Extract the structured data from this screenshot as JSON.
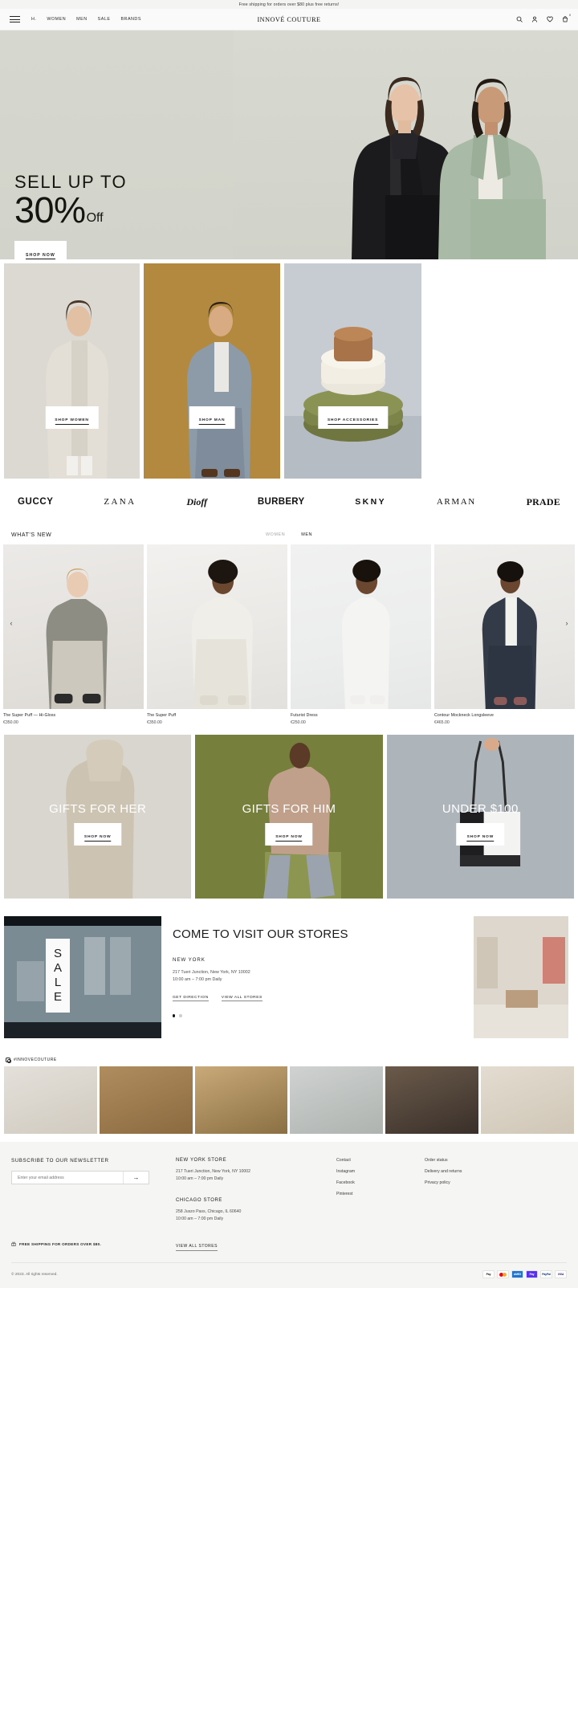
{
  "announcement": "Free shipping for orders over $80 plus free returns!",
  "header": {
    "brand": "INNOVÉ COUTURE",
    "menu_icon": "hamburger-icon",
    "nav": [
      {
        "label": "H."
      },
      {
        "label": "WOMEN"
      },
      {
        "label": "MEN"
      },
      {
        "label": "SALE"
      },
      {
        "label": "BRANDS"
      }
    ],
    "icons": {
      "search": "search-icon",
      "account": "user-icon",
      "wishlist": "heart-icon",
      "cart": "bag-icon",
      "cart_count": "0"
    }
  },
  "hero": {
    "line1": "SELL UP TO",
    "percent": "30%",
    "off": "Off",
    "cta": "SHOP NOW"
  },
  "categories": [
    {
      "cta": "SHOP WOMEN"
    },
    {
      "cta": "SHOP MAN"
    },
    {
      "cta": "SHOP ACCESSORIES"
    }
  ],
  "brands": [
    "GUCCY",
    "ZANA",
    "Dioff",
    "BURBERY",
    "SKNY",
    "ARMAN",
    "PRADE"
  ],
  "whats_new": {
    "title": "WHAT'S NEW",
    "tabs": [
      {
        "label": "WOMEN",
        "active": false
      },
      {
        "label": "MEN",
        "active": true
      }
    ],
    "prev_icon": "chevron-left-icon",
    "next_icon": "chevron-right-icon",
    "products": [
      {
        "name": "The Super Puff — Hi-Gloss",
        "price": "€350.00"
      },
      {
        "name": "The Super Puff",
        "price": "€350.00"
      },
      {
        "name": "Futurist Dress",
        "price": "€250.00"
      },
      {
        "name": "Contour Mockneck Longsleeve",
        "price": "€465.00"
      }
    ]
  },
  "gifts": [
    {
      "title": "GIFTS FOR HER",
      "cta": "SHOP NOW"
    },
    {
      "title": "GIFTS FOR HIM",
      "cta": "SHOP NOW"
    },
    {
      "title": "UNDER $100",
      "cta": "SHOP NOW"
    }
  ],
  "stores_section": {
    "sign_text": "SALE",
    "heading": "COME TO VISIT OUR STORES",
    "city": "NEW YORK",
    "address": "217 Tueri Junction, New York, NY 10002",
    "hours": "10:00 am – 7:00 pm Daily",
    "link_direction": "GET DIRECTION",
    "link_all": "VIEW ALL STORES",
    "dots": [
      true,
      false
    ]
  },
  "instagram": {
    "icon": "instagram-icon",
    "tag": "#INNOVECOUTURE"
  },
  "footer": {
    "newsletter": {
      "heading": "SUBSCRIBE TO OUR NEWSLETTER",
      "placeholder": "Enter your email address",
      "value": "",
      "submit_icon": "arrow-right-icon"
    },
    "shipping_note": "FREE SHIPPING FOR ORDERS OVER $80.",
    "shipping_icon": "gift-icon",
    "stores": [
      {
        "name": "NEW YORK STORE",
        "address": "217 Tueri Junction, New York, NY 10002",
        "hours": "10:00 am – 7:00 pm Daily"
      },
      {
        "name": "CHICAGO STORE",
        "address": "258 Juszo Pass, Chicago, IL 60640",
        "hours": "10:00 am – 7:00 pm Daily"
      }
    ],
    "view_all": "VIEW ALL STORES",
    "links_col1": [
      "Contact",
      "Instagram",
      "Facebook",
      "Pinterest"
    ],
    "links_col2": [
      "Order status",
      "Delivery and returns",
      "Privacy policy"
    ],
    "copyright": "© 2023. All rights reserved.",
    "payments": [
      "Pay",
      "mastercard",
      "AMEX",
      "Pay",
      "PayPal",
      "VISA"
    ]
  }
}
